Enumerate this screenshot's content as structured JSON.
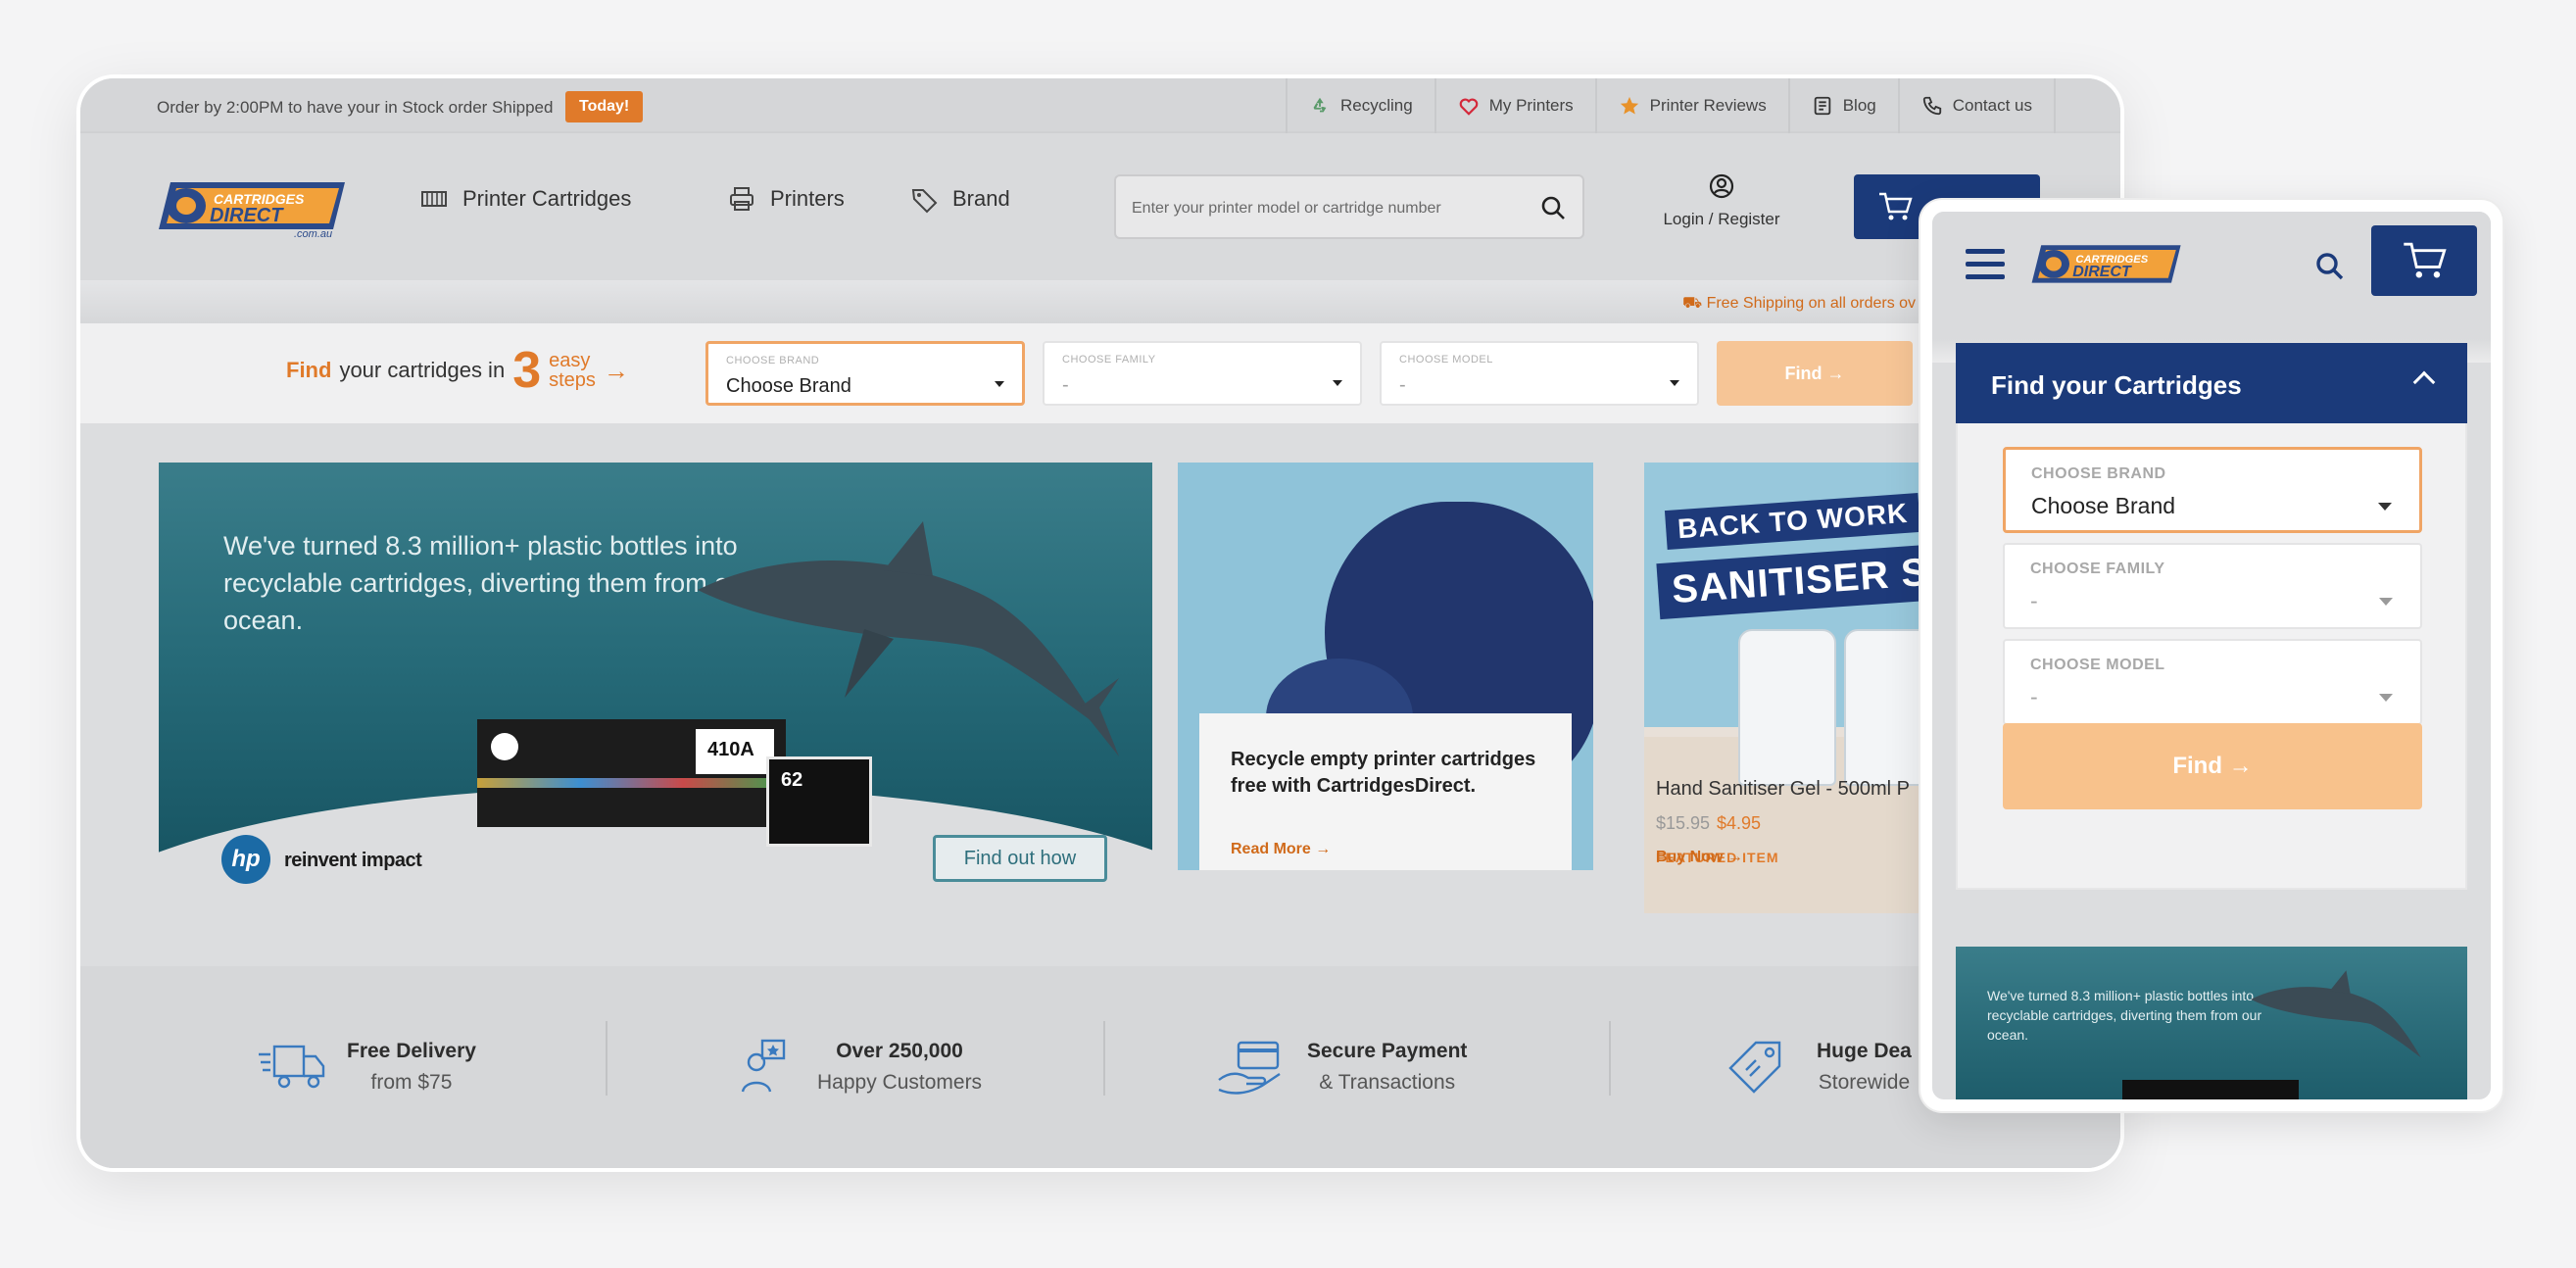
{
  "desktop": {
    "topbar": {
      "order_text": "Order by 2:00PM to have your in Stock order Shipped",
      "today_badge": "Today!",
      "links": [
        {
          "label": "Recycling",
          "icon": "recycle-icon"
        },
        {
          "label": "My Printers",
          "icon": "heart-icon"
        },
        {
          "label": "Printer Reviews",
          "icon": "star-icon"
        },
        {
          "label": "Blog",
          "icon": "blog-icon"
        },
        {
          "label": "Contact us",
          "icon": "phone-icon"
        }
      ]
    },
    "header": {
      "logo_text": "CARTRIDGES DIRECT .com.au",
      "nav": [
        {
          "label": "Printer Cartridges",
          "icon": "cartridge-icon"
        },
        {
          "label": "Printers",
          "icon": "printer-icon"
        },
        {
          "label": "Brand",
          "icon": "tag-icon"
        }
      ],
      "search_placeholder": "Enter your printer model or cartridge number",
      "login_label": "Login / Register"
    },
    "shipping_notice": "Free Shipping on all orders ov",
    "finder": {
      "find_word": "Find",
      "label_rest": "your cartridges in",
      "number": "3",
      "easy": "easy",
      "steps": "steps",
      "brand": {
        "caption": "CHOOSE BRAND",
        "value": "Choose Brand"
      },
      "family": {
        "caption": "CHOOSE FAMILY",
        "value": "-"
      },
      "model": {
        "caption": "CHOOSE MODEL",
        "value": "-"
      },
      "button": "Find →"
    },
    "hero": {
      "text": "We've turned 8.3 million+ plastic bottles into recyclable cartridges, diverting them from our ocean.",
      "cartridge_label": "410A",
      "cartridge2_label": "62",
      "hp_logo": "hp",
      "tagline": "reinvent impact",
      "cta": "Find out how"
    },
    "promo_recycle": {
      "text": "Recycle empty printer cartridges free with CartridgesDirect.",
      "link": "Read More →"
    },
    "promo_featured": {
      "banner1": "BACK TO WORK",
      "banner2": "SANITISER SA",
      "tag": "FEATURED ITEM",
      "name": "Hand Sanitiser Gel - 500ml P",
      "old_price": "$15.95",
      "new_price": "$4.95",
      "link": "Buy Now →"
    },
    "features": [
      {
        "title": "Free Delivery",
        "sub": "from $75",
        "icon": "delivery-truck-icon"
      },
      {
        "title": "Over 250,000",
        "sub": "Happy Customers",
        "icon": "customers-icon"
      },
      {
        "title": "Secure Payment",
        "sub": "& Transactions",
        "icon": "payment-card-icon"
      },
      {
        "title": "Huge Dea",
        "sub": "Storewide",
        "icon": "price-tag-icon"
      }
    ]
  },
  "mobile": {
    "panel_title": "Find your Cartridges",
    "brand": {
      "caption": "CHOOSE BRAND",
      "value": "Choose Brand"
    },
    "family": {
      "caption": "CHOOSE FAMILY",
      "value": "-"
    },
    "model": {
      "caption": "CHOOSE MODEL",
      "value": "-"
    },
    "button": "Find →",
    "hero_text": "We've turned 8.3 million+ plastic bottles into recyclable cartridges, diverting them from our ocean."
  },
  "colors": {
    "brand_blue": "#1b3a7a",
    "accent_orange": "#e07a2a",
    "find_button": "#f6c596",
    "active_border": "#f0a565"
  }
}
